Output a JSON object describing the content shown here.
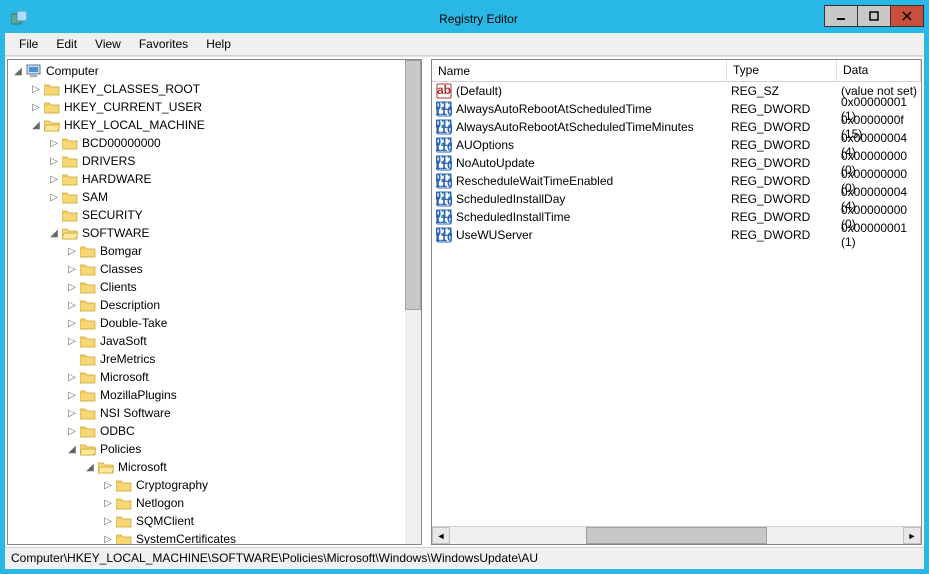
{
  "window": {
    "title": "Registry Editor"
  },
  "menu": {
    "file": "File",
    "edit": "Edit",
    "view": "View",
    "favorites": "Favorites",
    "help": "Help"
  },
  "tree": {
    "root": "Computer",
    "hkcr": "HKEY_CLASSES_ROOT",
    "hkcu": "HKEY_CURRENT_USER",
    "hklm": "HKEY_LOCAL_MACHINE",
    "hklm_children": {
      "bcd": "BCD00000000",
      "drivers": "DRIVERS",
      "hardware": "HARDWARE",
      "sam": "SAM",
      "security": "SECURITY",
      "software": "SOFTWARE"
    },
    "software_children": {
      "bomgar": "Bomgar",
      "classes": "Classes",
      "clients": "Clients",
      "description": "Description",
      "doubletake": "Double-Take",
      "javasoft": "JavaSoft",
      "jremetrics": "JreMetrics",
      "microsoft": "Microsoft",
      "mozillaplugins": "MozillaPlugins",
      "nsi": "NSI Software",
      "odbc": "ODBC",
      "policies": "Policies"
    },
    "policies_children": {
      "microsoft": "Microsoft"
    },
    "policies_ms_children": {
      "cryptography": "Cryptography",
      "netlogon": "Netlogon",
      "sqmclient": "SQMClient",
      "systemcertificates": "SystemCertificates"
    }
  },
  "columns": {
    "name": "Name",
    "type": "Type",
    "data": "Data"
  },
  "values": [
    {
      "icon": "sz",
      "name": "(Default)",
      "type": "REG_SZ",
      "data": "(value not set)"
    },
    {
      "icon": "dword",
      "name": "AlwaysAutoRebootAtScheduledTime",
      "type": "REG_DWORD",
      "data": "0x00000001 (1)"
    },
    {
      "icon": "dword",
      "name": "AlwaysAutoRebootAtScheduledTimeMinutes",
      "type": "REG_DWORD",
      "data": "0x0000000f (15)"
    },
    {
      "icon": "dword",
      "name": "AUOptions",
      "type": "REG_DWORD",
      "data": "0x00000004 (4)"
    },
    {
      "icon": "dword",
      "name": "NoAutoUpdate",
      "type": "REG_DWORD",
      "data": "0x00000000 (0)"
    },
    {
      "icon": "dword",
      "name": "RescheduleWaitTimeEnabled",
      "type": "REG_DWORD",
      "data": "0x00000000 (0)"
    },
    {
      "icon": "dword",
      "name": "ScheduledInstallDay",
      "type": "REG_DWORD",
      "data": "0x00000004 (4)"
    },
    {
      "icon": "dword",
      "name": "ScheduledInstallTime",
      "type": "REG_DWORD",
      "data": "0x00000000 (0)"
    },
    {
      "icon": "dword",
      "name": "UseWUServer",
      "type": "REG_DWORD",
      "data": "0x00000001 (1)"
    }
  ],
  "statusbar": "Computer\\HKEY_LOCAL_MACHINE\\SOFTWARE\\Policies\\Microsoft\\Windows\\WindowsUpdate\\AU"
}
